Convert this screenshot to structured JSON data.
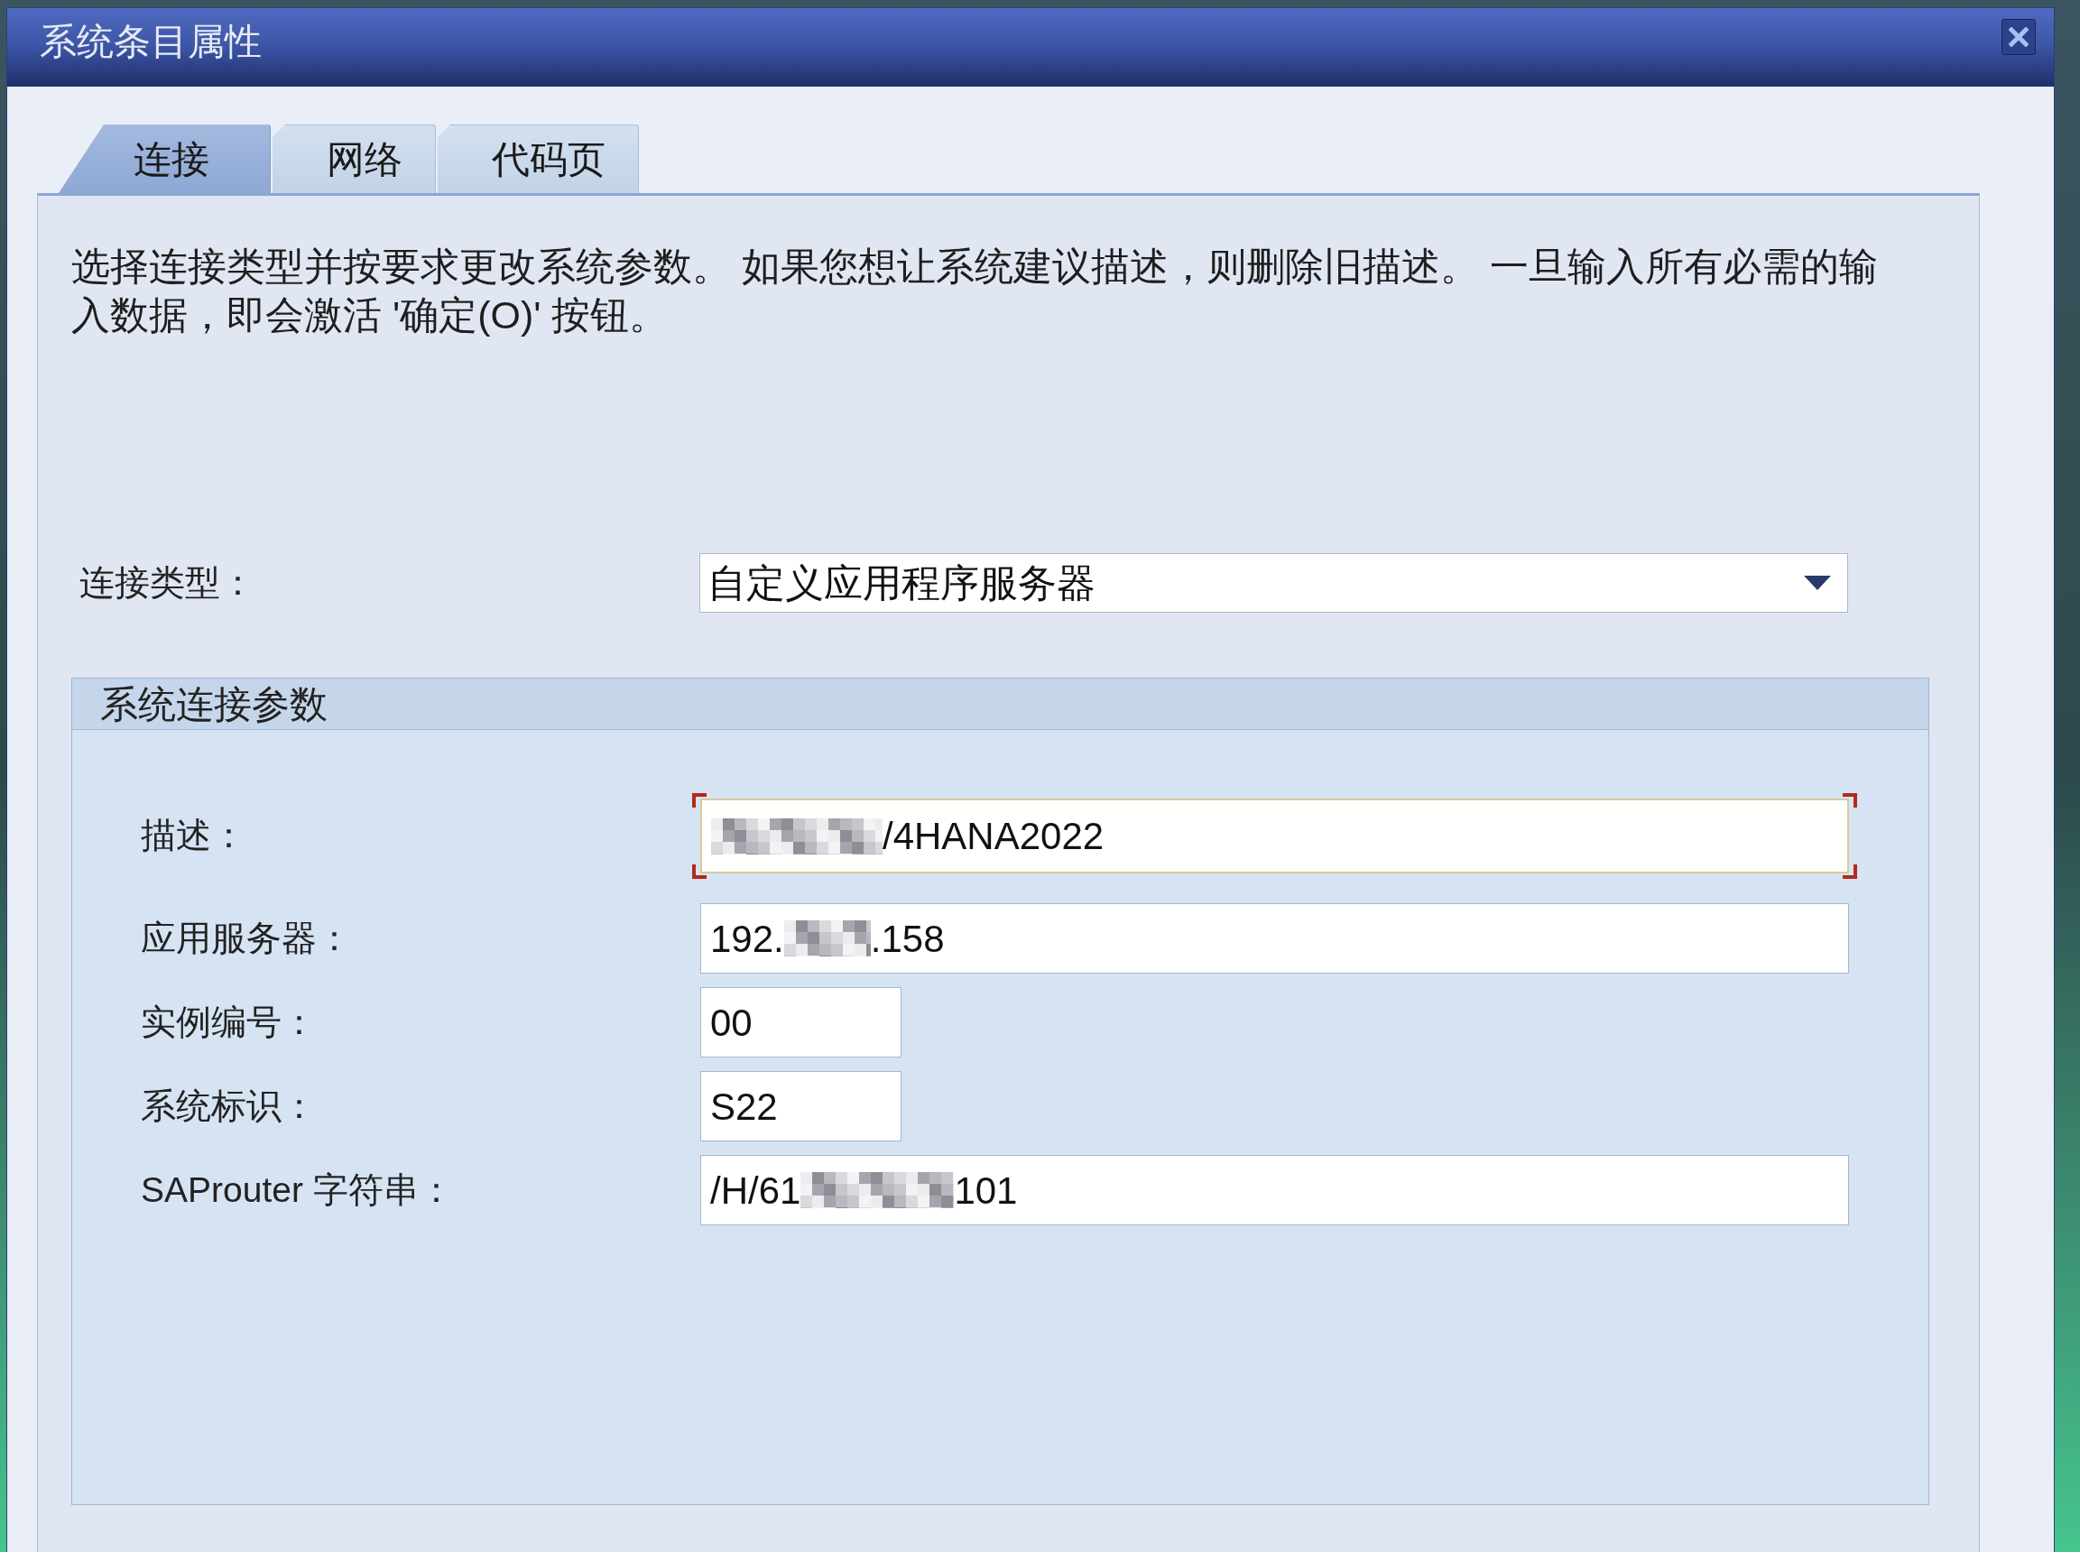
{
  "window": {
    "title": "系统条目属性"
  },
  "tabs": [
    {
      "label": "连接",
      "selected": true
    },
    {
      "label": "网络",
      "selected": false
    },
    {
      "label": "代码页",
      "selected": false
    }
  ],
  "instructions": "选择连接类型并按要求更改系统参数。 如果您想让系统建议描述，则删除旧描述。 一旦输入所有必需的输入数据，即会激活 '确定(O)' 按钮。",
  "connection_type": {
    "label": "连接类型：",
    "value": "自定义应用程序服务器"
  },
  "connection_parameters": {
    "title": "系统连接参数",
    "fields": [
      {
        "label": "描述：",
        "kind": "wide",
        "focused": true,
        "value_parts": [
          {
            "kind": "redacted"
          },
          {
            "kind": "text",
            "text": "/4HANA2022"
          }
        ]
      },
      {
        "label": "应用服务器：",
        "kind": "wide",
        "focused": false,
        "value_parts": [
          {
            "kind": "text",
            "text": "192."
          },
          {
            "kind": "redacted"
          },
          {
            "kind": "text",
            "text": ".158"
          }
        ]
      },
      {
        "label": "实例编号：",
        "kind": "short",
        "focused": false,
        "value_parts": [
          {
            "kind": "text",
            "text": "00"
          }
        ]
      },
      {
        "label": "系统标识：",
        "kind": "short",
        "focused": false,
        "value_parts": [
          {
            "kind": "text",
            "text": "S22"
          }
        ]
      },
      {
        "label": "SAProuter 字符串：",
        "kind": "wide",
        "focused": false,
        "value_parts": [
          {
            "kind": "text",
            "text": "/H/61"
          },
          {
            "kind": "redacted"
          },
          {
            "kind": "text",
            "text": "101"
          }
        ]
      }
    ]
  }
}
